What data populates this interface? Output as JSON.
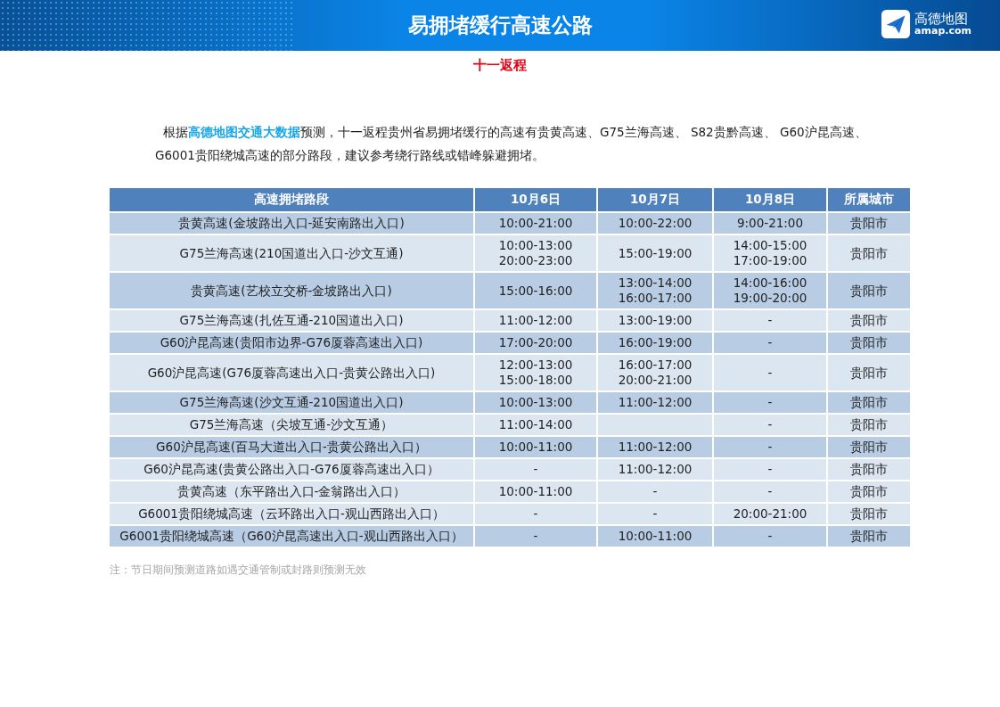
{
  "header": {
    "title": "易拥堵缓行高速公路",
    "logo": {
      "name": "高德地图",
      "domain": "amap.com"
    }
  },
  "subtitle": "十一返程",
  "intro": "根据**高德地图交通大数据**预测，十一返程贵州省易拥堵缓行的高速有贵黄高速、G75兰海高速、 S82贵黔高速、 G60沪昆高速、G6001贵阳绕城高速的部分路段，建议参考绕行路线或错峰躲避拥堵。",
  "table": {
    "columns": [
      "高速拥堵路段",
      "10月6日",
      "10月7日",
      "10月8日",
      "所属城市"
    ],
    "rows": [
      {
        "shaded": true,
        "cells": [
          [
            "贵黄高速(金坡路出入口-延安南路出入口)"
          ],
          [
            "10:00-21:00"
          ],
          [
            "10:00-22:00"
          ],
          [
            "9:00-21:00"
          ],
          [
            "贵阳市"
          ]
        ]
      },
      {
        "shaded": false,
        "cells": [
          [
            "G75兰海高速(210国道出入口-沙文互通)"
          ],
          [
            "10:00-13:00",
            "20:00-23:00"
          ],
          [
            "15:00-19:00"
          ],
          [
            "14:00-15:00",
            "17:00-19:00"
          ],
          [
            "贵阳市"
          ]
        ]
      },
      {
        "shaded": true,
        "cells": [
          [
            "贵黄高速(艺校立交桥-金坡路出入口)"
          ],
          [
            "15:00-16:00"
          ],
          [
            "13:00-14:00",
            "16:00-17:00"
          ],
          [
            "14:00-16:00",
            "19:00-20:00"
          ],
          [
            "贵阳市"
          ]
        ]
      },
      {
        "shaded": false,
        "cells": [
          [
            "G75兰海高速(扎佐互通-210国道出入口)"
          ],
          [
            "11:00-12:00"
          ],
          [
            "13:00-19:00"
          ],
          [
            "-"
          ],
          [
            "贵阳市"
          ]
        ]
      },
      {
        "shaded": true,
        "cells": [
          [
            "G60沪昆高速(贵阳市边界-G76厦蓉高速出入口)"
          ],
          [
            "17:00-20:00"
          ],
          [
            "16:00-19:00"
          ],
          [
            "-"
          ],
          [
            "贵阳市"
          ]
        ]
      },
      {
        "shaded": false,
        "cells": [
          [
            "G60沪昆高速(G76厦蓉高速出入口-贵黄公路出入口)"
          ],
          [
            "12:00-13:00",
            "15:00-18:00"
          ],
          [
            "16:00-17:00",
            "20:00-21:00"
          ],
          [
            "-"
          ],
          [
            "贵阳市"
          ]
        ]
      },
      {
        "shaded": true,
        "cells": [
          [
            "G75兰海高速(沙文互通-210国道出入口)"
          ],
          [
            "10:00-13:00"
          ],
          [
            "11:00-12:00"
          ],
          [
            "-"
          ],
          [
            "贵阳市"
          ]
        ]
      },
      {
        "shaded": false,
        "cells": [
          [
            "G75兰海高速（尖坡互通-沙文互通）"
          ],
          [
            "11:00-14:00"
          ],
          [],
          [
            "-"
          ],
          [
            "贵阳市"
          ]
        ]
      },
      {
        "shaded": true,
        "cells": [
          [
            "G60沪昆高速(百马大道出入口-贵黄公路出入口）"
          ],
          [
            "10:00-11:00"
          ],
          [
            "11:00-12:00"
          ],
          [
            "-"
          ],
          [
            "贵阳市"
          ]
        ]
      },
      {
        "shaded": false,
        "cells": [
          [
            "G60沪昆高速(贵黄公路出入口-G76厦蓉高速出入口）"
          ],
          [
            "-"
          ],
          [
            "11:00-12:00"
          ],
          [
            "-"
          ],
          [
            "贵阳市"
          ]
        ]
      },
      {
        "shaded": false,
        "cells": [
          [
            "贵黄高速（东平路出入口-金翁路出入口）"
          ],
          [
            "10:00-11:00"
          ],
          [
            "-"
          ],
          [
            "-"
          ],
          [
            "贵阳市"
          ]
        ]
      },
      {
        "shaded": false,
        "cells": [
          [
            "G6001贵阳绕城高速（云环路出入口-观山西路出入口）"
          ],
          [
            "-"
          ],
          [
            "-"
          ],
          [
            "20:00-21:00"
          ],
          [
            "贵阳市"
          ]
        ]
      },
      {
        "shaded": true,
        "cells": [
          [
            "G6001贵阳绕城高速（G60沪昆高速出入口-观山西路出入口）"
          ],
          [
            "-"
          ],
          [
            "10:00-11:00"
          ],
          [
            "-"
          ],
          [
            "贵阳市"
          ]
        ]
      }
    ]
  },
  "note": "注：节日期间预测道路如遇交通管制或封路则预测无效"
}
